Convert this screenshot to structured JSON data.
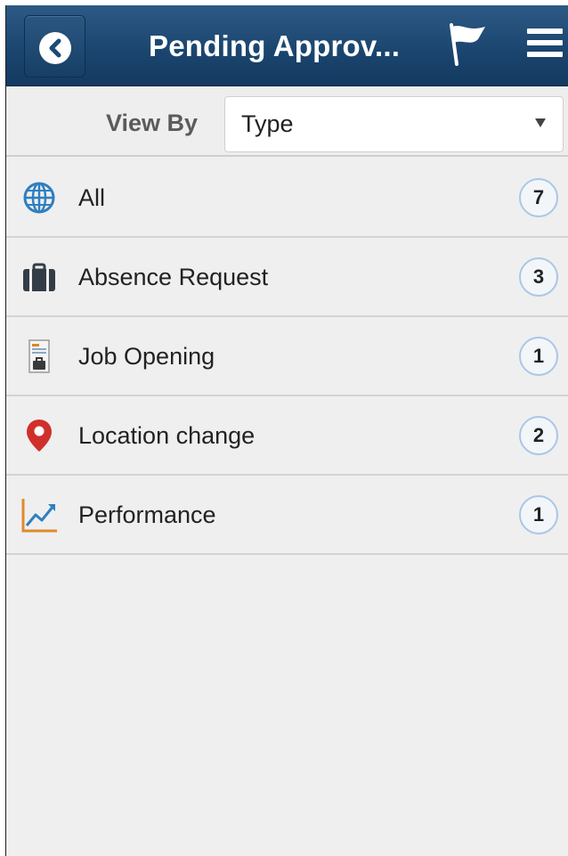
{
  "header": {
    "title": "Pending Approv...",
    "back_icon": "back-arrow-icon",
    "flag_icon": "flag-icon",
    "menu_icon": "hamburger-menu-icon",
    "colors": {
      "bar": "#1b4670",
      "text": "#ffffff"
    }
  },
  "view_by": {
    "label": "View By",
    "selected": "Type"
  },
  "categories": [
    {
      "label": "All",
      "count": "7",
      "icon": "globe-icon"
    },
    {
      "label": "Absence Request",
      "count": "3",
      "icon": "briefcase-icon"
    },
    {
      "label": "Job Opening",
      "count": "1",
      "icon": "job-document-icon"
    },
    {
      "label": "Location change",
      "count": "2",
      "icon": "map-pin-icon"
    },
    {
      "label": "Performance",
      "count": "1",
      "icon": "line-chart-icon"
    }
  ]
}
